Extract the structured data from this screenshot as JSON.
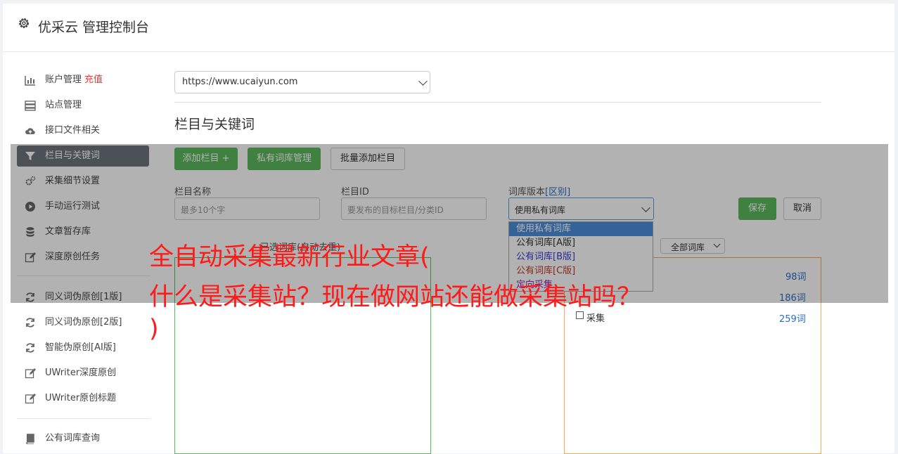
{
  "header": {
    "title": "优采云 管理控制台",
    "icon": "gear-icon"
  },
  "sidebar": {
    "items": [
      {
        "label": "账户管理",
        "badge": "充值",
        "icon": "bar-chart-icon"
      },
      {
        "label": "站点管理",
        "icon": "server-icon"
      },
      {
        "label": "接口文件相关",
        "icon": "cloud-upload-icon"
      },
      {
        "label": "栏目与关键词",
        "icon": "filter-icon",
        "active": true
      },
      {
        "label": "采集细节设置",
        "icon": "gears-icon"
      },
      {
        "label": "手动运行测试",
        "icon": "play-circle-icon"
      },
      {
        "label": "文章暂存库",
        "icon": "database-icon"
      },
      {
        "label": "深度原创任务",
        "icon": "edit-icon"
      },
      {
        "label": "同义词伪原创[1版]",
        "icon": "refresh-icon"
      },
      {
        "label": "同义词伪原创[2版]",
        "icon": "refresh-icon"
      },
      {
        "label": "智能伪原创[AI版]",
        "icon": "refresh-icon"
      },
      {
        "label": "UWriter深度原创",
        "icon": "edit-icon"
      },
      {
        "label": "UWriter原创标题",
        "icon": "edit-icon"
      },
      {
        "label": "公有词库查询",
        "icon": "book-icon"
      }
    ]
  },
  "main": {
    "site_select": "https://www.ucaiyun.com",
    "section_title": "栏目与关键词",
    "buttons": {
      "add_column": "添加栏目 +",
      "private_lib": "私有词库管理",
      "batch_add": "批量添加栏目"
    },
    "form": {
      "name_label": "栏目名称",
      "name_placeholder": "最多10个字",
      "id_label": "栏目ID",
      "id_placeholder": "要发布的目标栏目/分类ID",
      "version_label": "词库版本",
      "version_link": "[区别]",
      "version_value": "使用私有词库",
      "save": "保存",
      "cancel": "取消"
    },
    "dropdown_options": [
      {
        "label": "使用私有词库",
        "color": "#ffffff",
        "selected": true
      },
      {
        "label": "公有词库[A版]",
        "color": "#333333"
      },
      {
        "label": "公有词库[B版]",
        "color": "#3a3ad6"
      },
      {
        "label": "公有词库[C版]",
        "color": "#c0392b"
      },
      {
        "label": "定向采集",
        "color": "#9b27b0"
      }
    ],
    "selected_lib_label": "已选词库(自动去重)",
    "filter_select": "全部词库",
    "lib_rows": [
      {
        "name": "",
        "count": "98词"
      },
      {
        "name": "",
        "count": "186词"
      },
      {
        "name": "采集",
        "count": "259词"
      }
    ]
  },
  "banner": {
    "line1": "全自动采集最新行业文章(",
    "line2": "什么是采集站？现在做网站还能做采集站吗？",
    "line3": ")"
  }
}
